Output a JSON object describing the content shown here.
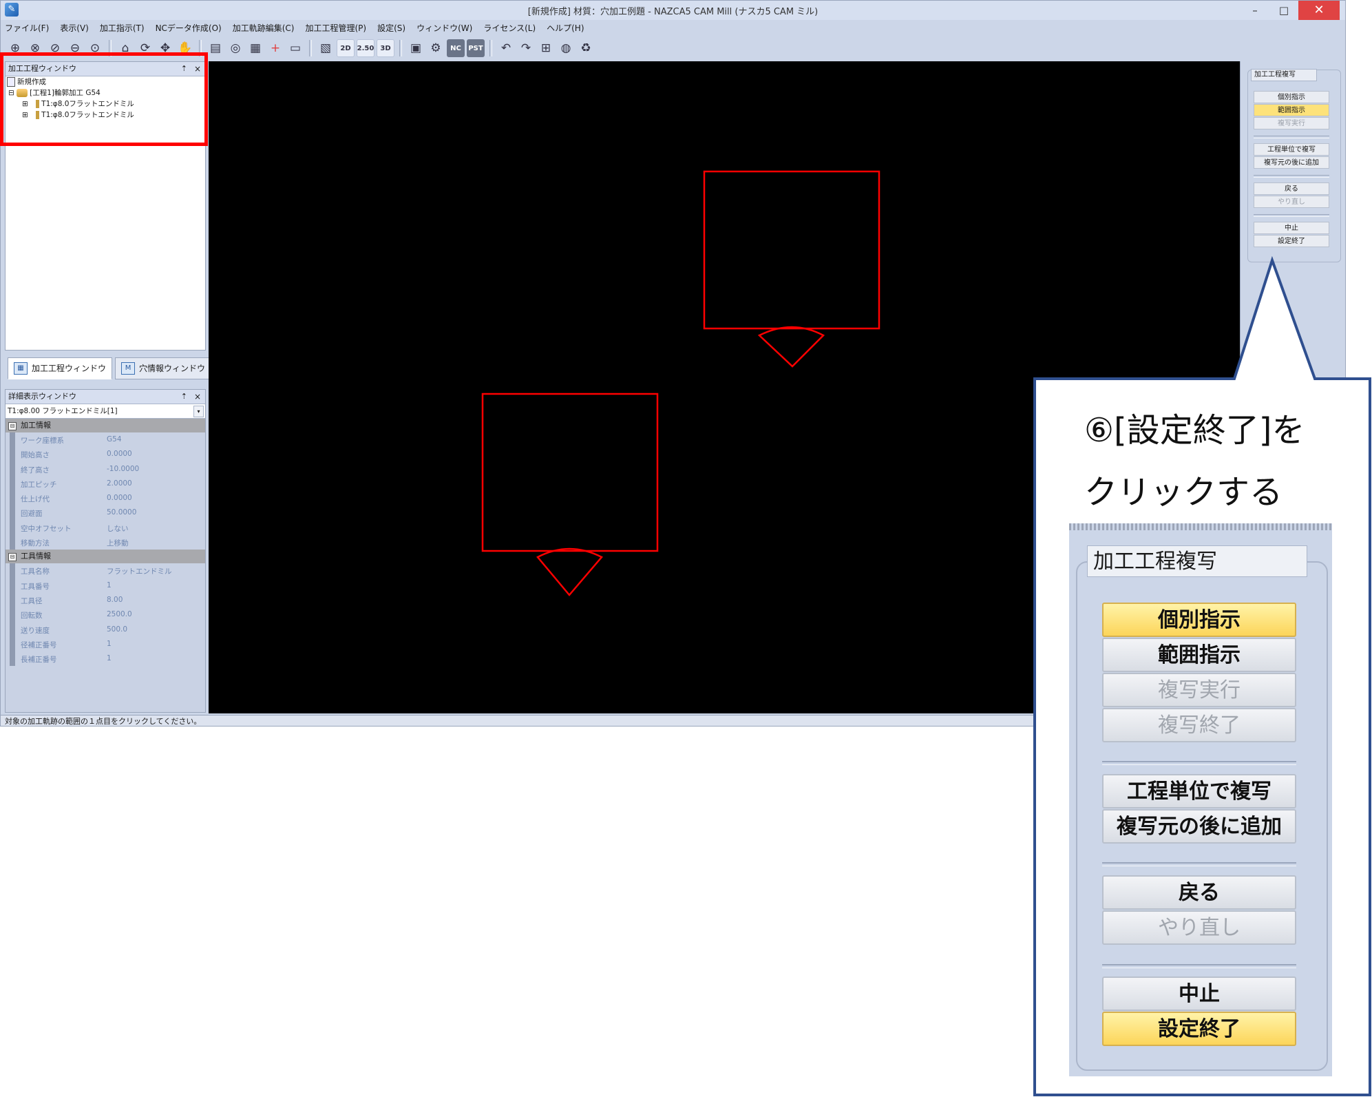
{
  "window": {
    "title": "[新規作成] 材質：穴加工例題 - NAZCA5 CAM Mill (ナスカ5 CAM ミル)",
    "minimize": "–",
    "maximize": "□",
    "close": "✕"
  },
  "menu": [
    "ファイル(F)",
    "表示(V)",
    "加工指示(T)",
    "NCデータ作成(O)",
    "加工軌跡編集(C)",
    "加工工程管理(P)",
    "設定(S)",
    "ウィンドウ(W)",
    "ライセンス(L)",
    "ヘルプ(H)"
  ],
  "toolbar": {
    "b2d": "2D",
    "b250": "2.50",
    "b3d": "3D",
    "nc": "NC",
    "pst": "PST"
  },
  "process_window": {
    "title": "加工工程ウィンドウ",
    "pin": "⇡",
    "close": "×",
    "tree": {
      "root": "新規作成",
      "process": "[工程1]輪郭加工 G54",
      "tool1": "T1:φ8.0フラットエンドミル",
      "tool2": "T1:φ8.0フラットエンドミル",
      "expand": "⊞",
      "collapse": "⊟"
    }
  },
  "tabs": {
    "process": "加工工程ウィンドウ",
    "hole": "穴情報ウィンドウ",
    "hole_icon": "M"
  },
  "detail_window": {
    "title": "詳細表示ウィンドウ",
    "pin": "⇡",
    "close": "×",
    "selected": "T1:φ8.00 フラットエンドミル[1]",
    "dropdown": "▾",
    "section1": "加工情報",
    "section2": "工具情報",
    "toggle": "⊟",
    "machining": [
      {
        "k": "ワーク座標系",
        "v": "G54"
      },
      {
        "k": "開始高さ",
        "v": "0.0000"
      },
      {
        "k": "終了高さ",
        "v": "-10.0000"
      },
      {
        "k": "加工ピッチ",
        "v": "2.0000"
      },
      {
        "k": "仕上げ代",
        "v": "0.0000"
      },
      {
        "k": "回避面",
        "v": "50.0000"
      },
      {
        "k": "空中オフセット",
        "v": "しない"
      },
      {
        "k": "移動方法",
        "v": "上移動"
      }
    ],
    "tool": [
      {
        "k": "工具名称",
        "v": "フラットエンドミル"
      },
      {
        "k": "工具番号",
        "v": "1"
      },
      {
        "k": "工具径",
        "v": "8.00"
      },
      {
        "k": "回転数",
        "v": "2500.0"
      },
      {
        "k": "送り速度",
        "v": "500.0"
      },
      {
        "k": "径補正番号",
        "v": "1"
      },
      {
        "k": "長補正番号",
        "v": "1"
      }
    ]
  },
  "copy_panel": {
    "title": "加工工程複写",
    "individual": "個別指示",
    "range": "範囲指示",
    "execute": "複写実行",
    "end_copy": "複写終了",
    "by_process": "工程単位で複写",
    "append": "複写元の後に追加",
    "undo": "戻る",
    "redo": "やり直し",
    "cancel": "中止",
    "finish": "設定終了"
  },
  "status": "対象の加工軌跡の範囲の１点目をクリックしてください。",
  "callout": {
    "line1": "⑥[設定終了]を",
    "line2": "クリックする"
  },
  "colors": {
    "highlight": "#fde27a",
    "path": "#ff0000",
    "callout_border": "#2f4f8f",
    "annotation_box": "#ff0000"
  }
}
